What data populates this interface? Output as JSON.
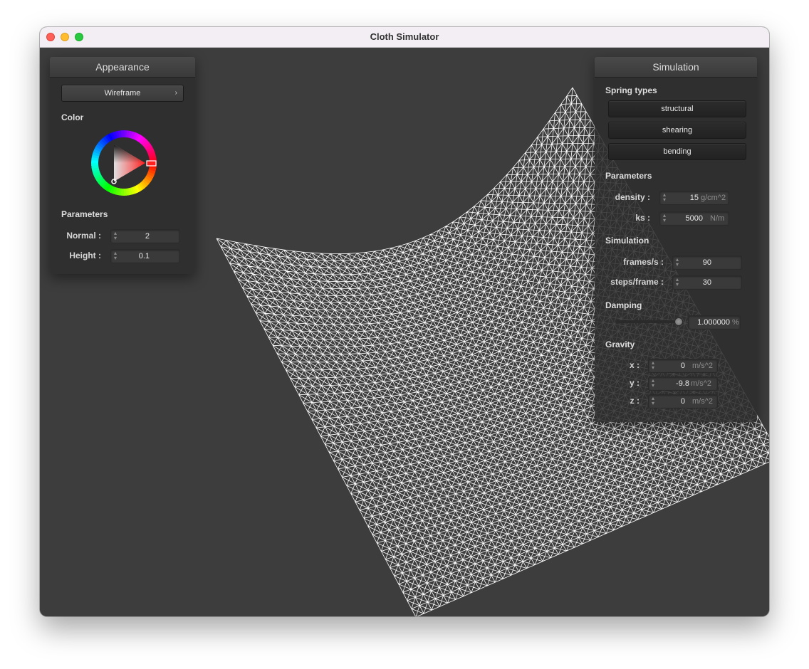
{
  "window": {
    "title": "Cloth Simulator"
  },
  "appearance": {
    "header": "Appearance",
    "shader_selected": "Wireframe",
    "color_label": "Color",
    "color": "#ff2020",
    "parameters_label": "Parameters",
    "normal": {
      "label": "Normal :",
      "value": "2"
    },
    "height": {
      "label": "Height :",
      "value": "0.1"
    }
  },
  "simulation": {
    "header": "Simulation",
    "spring_types_label": "Spring types",
    "spring_buttons": [
      "structural",
      "shearing",
      "bending"
    ],
    "parameters_label": "Parameters",
    "density": {
      "label": "density :",
      "value": "15",
      "unit": "g/cm^2"
    },
    "ks": {
      "label": "ks :",
      "value": "5000",
      "unit": "N/m"
    },
    "simulation_label": "Simulation",
    "fps": {
      "label": "frames/s :",
      "value": "90"
    },
    "steps": {
      "label": "steps/frame :",
      "value": "30"
    },
    "damping_label": "Damping",
    "damping": {
      "value": "1.000000",
      "unit": "%",
      "slider_fraction": 1.0
    },
    "gravity_label": "Gravity",
    "gravity": {
      "x": {
        "label": "x :",
        "value": "0",
        "unit": "m/s^2"
      },
      "y": {
        "label": "y :",
        "value": "-9.8",
        "unit": "m/s^2"
      },
      "z": {
        "label": "z :",
        "value": "0",
        "unit": "m/s^2"
      }
    }
  },
  "cloth": {
    "render_mode": "wireframe",
    "line_color": "#ffffff"
  }
}
